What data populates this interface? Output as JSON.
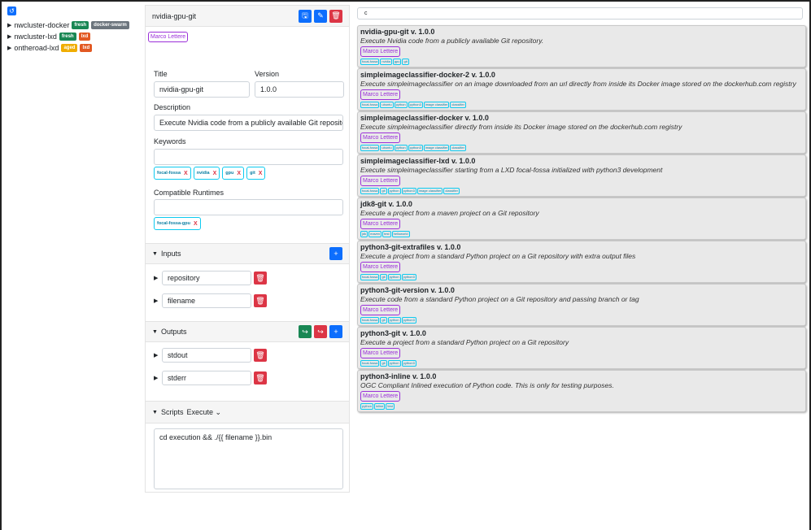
{
  "tree": {
    "refresh_icon": "↺",
    "items": [
      {
        "name": "nwcluster-docker",
        "badges": [
          {
            "text": "fresh",
            "color": "#198754"
          },
          {
            "text": "docker-swarm",
            "color": "#6c757d"
          }
        ]
      },
      {
        "name": "nwcluster-lxd",
        "badges": [
          {
            "text": "fresh",
            "color": "#198754"
          },
          {
            "text": "lxd",
            "color": "#e25822"
          }
        ]
      },
      {
        "name": "ontheroad-lxd",
        "badges": [
          {
            "text": "aged",
            "color": "#f0ad00"
          },
          {
            "text": "lxd",
            "color": "#e25822"
          }
        ]
      }
    ]
  },
  "editor": {
    "title": "nvidia-gpu-git",
    "author": "Marco Lettere",
    "title_label": "Title",
    "title_value": "nvidia-gpu-git",
    "version_label": "Version",
    "version_value": "1.0.0",
    "description_label": "Description",
    "description_value": "Execute Nvidia code from a publicly available Git reposito",
    "keywords_label": "Keywords",
    "keywords": [
      "focal-fossa",
      "nvidia",
      "gpu",
      "git"
    ],
    "runtimes_label": "Compatible Runtimes",
    "runtimes": [
      "focal-fossa-gpu"
    ],
    "remove_mark": "X",
    "inputs_label": "Inputs",
    "inputs": [
      "repository",
      "filename"
    ],
    "outputs_label": "Outputs",
    "outputs": [
      "stdout",
      "stderr"
    ],
    "scripts_label": "Scripts",
    "scripts_select": "Execute",
    "script_text": "cd execution && ./{{ filename }}.bin"
  },
  "search": {
    "value": "c"
  },
  "catalog": [
    {
      "title": "nvidia-gpu-git v. 1.0.0",
      "desc": "Execute Nvidia code from a publicly available Git repository.",
      "author": "Marco Lettere",
      "tags": [
        "focal-fossa",
        "nvidia",
        "gpu",
        "git"
      ]
    },
    {
      "title": "simpleimageclassifier-docker-2 v. 1.0.0",
      "desc": "Execute simpleimageclassifier on an image downloaded from an url directly from inside its Docker image stored on the dockerhub.com registry",
      "author": "Marco Lettere",
      "tags": [
        "focal-fossa",
        "ubuntu",
        "python",
        "python3",
        "image classifier",
        "classifier"
      ]
    },
    {
      "title": "simpleimageclassifier-docker v. 1.0.0",
      "desc": "Execute simpleimageclassifier directly from inside its Docker image stored on the dockerhub.com registry",
      "author": "Marco Lettere",
      "tags": [
        "focal-fossa",
        "ubuntu",
        "python",
        "python3",
        "image classifier",
        "classifier"
      ]
    },
    {
      "title": "simpleimageclassifier-lxd v. 1.0.0",
      "desc": "Execute simpleimageclassifier starting from a LXD focal-fossa initialized with python3 development",
      "author": "Marco Lettere",
      "tags": [
        "focal-fossa",
        "git",
        "python",
        "python3",
        "image classifier",
        "classifier"
      ]
    },
    {
      "title": "jdk8-git v. 1.0.0",
      "desc": "Execute a project from a maven project on a Git repository",
      "author": "Marco Lettere",
      "tags": [
        "jdk",
        "maven",
        "test",
        "helloworld"
      ]
    },
    {
      "title": "python3-git-extrafiles v. 1.0.0",
      "desc": "Execute a project from a standard Python project on a Git repository with extra output files",
      "author": "Marco Lettere",
      "tags": [
        "focal-fossa",
        "git",
        "python",
        "python3"
      ]
    },
    {
      "title": "python3-git-version v. 1.0.0",
      "desc": "Execute code from a standard Python project on a Git repository and passing branch or tag",
      "author": "Marco Lettere",
      "tags": [
        "focal-fossa",
        "git",
        "python",
        "python3"
      ]
    },
    {
      "title": "python3-git v. 1.0.0",
      "desc": "Execute a project from a standard Python project on a Git repository",
      "author": "Marco Lettere",
      "tags": [
        "focal-fossa",
        "git",
        "python",
        "python3"
      ]
    },
    {
      "title": "python3-inline v. 1.0.0",
      "desc": "OGC Compliant Inlined execution of Python code. This is only for testing purposes.",
      "author": "Marco Lettere",
      "tags": [
        "python",
        "inline",
        "test"
      ]
    }
  ]
}
